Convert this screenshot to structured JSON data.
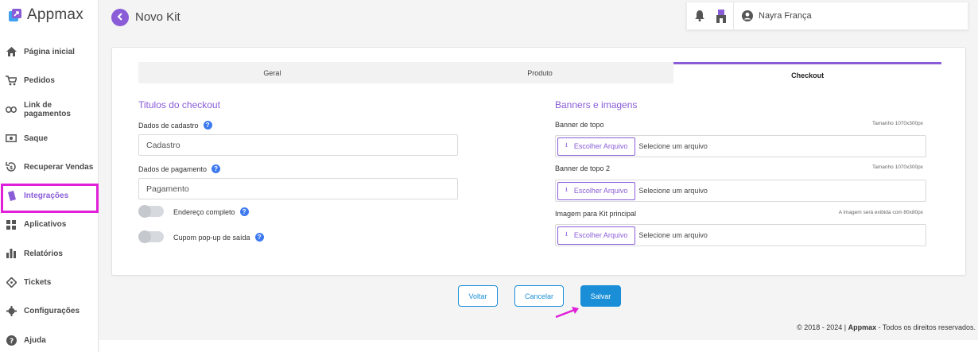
{
  "app": {
    "name": "Appmax",
    "brand_color": "#8a5cd8"
  },
  "sidebar": {
    "items": [
      {
        "label": "Página inicial",
        "icon": "home-icon"
      },
      {
        "label": "Pedidos",
        "icon": "cart-icon"
      },
      {
        "label": "Link de pagamentos",
        "icon": "link-icon"
      },
      {
        "label": "Saque",
        "icon": "money-icon"
      },
      {
        "label": "Recuperar Vendas",
        "icon": "recover-icon"
      },
      {
        "label": "Integrações",
        "icon": "puzzle-icon",
        "active": true
      },
      {
        "label": "Aplicativos",
        "icon": "apps-icon"
      },
      {
        "label": "Relatórios",
        "icon": "bar-chart-icon"
      },
      {
        "label": "Tickets",
        "icon": "ticket-icon"
      },
      {
        "label": "Configurações",
        "icon": "gear-icon"
      },
      {
        "label": "Ajuda",
        "icon": "help-icon"
      }
    ]
  },
  "header": {
    "title": "Novo Kit",
    "user_name": "Nayra França"
  },
  "tabs": [
    {
      "label": "Geral",
      "active": false
    },
    {
      "label": "Produto",
      "active": false
    },
    {
      "label": "Checkout",
      "active": true
    }
  ],
  "checkout_titles": {
    "section_title": "Titulos do checkout",
    "signup_label": "Dados de cadastro",
    "signup_value": "Cadastro",
    "payment_label": "Dados de pagamento",
    "payment_value": "Pagamento",
    "toggle_address_label": "Endereço completo",
    "toggle_popup_label": "Cupom pop-up de saída"
  },
  "banners": {
    "section_title": "Banners e imagens",
    "fields": [
      {
        "label": "Banner de topo",
        "hint": "Tamanho 1070x300px",
        "button": "Escolher Arquivo",
        "placeholder": "Selecione um arquivo"
      },
      {
        "label": "Banner de topo 2",
        "hint": "Tamanho 1070x300px",
        "button": "Escolher Arquivo",
        "placeholder": "Selecione um arquivo"
      },
      {
        "label": "Imagem para Kit principal",
        "hint": "A imagem será exibida com 80x80px",
        "button": "Escolher Arquivo",
        "placeholder": "Selecione um arquivo"
      }
    ]
  },
  "actions": {
    "back": "Voltar",
    "cancel": "Cancelar",
    "save": "Salvar"
  },
  "footer": {
    "prefix": "© 2018 - 2024 | ",
    "brand": "Appmax",
    "suffix": " - Todos os direitos reservados."
  }
}
